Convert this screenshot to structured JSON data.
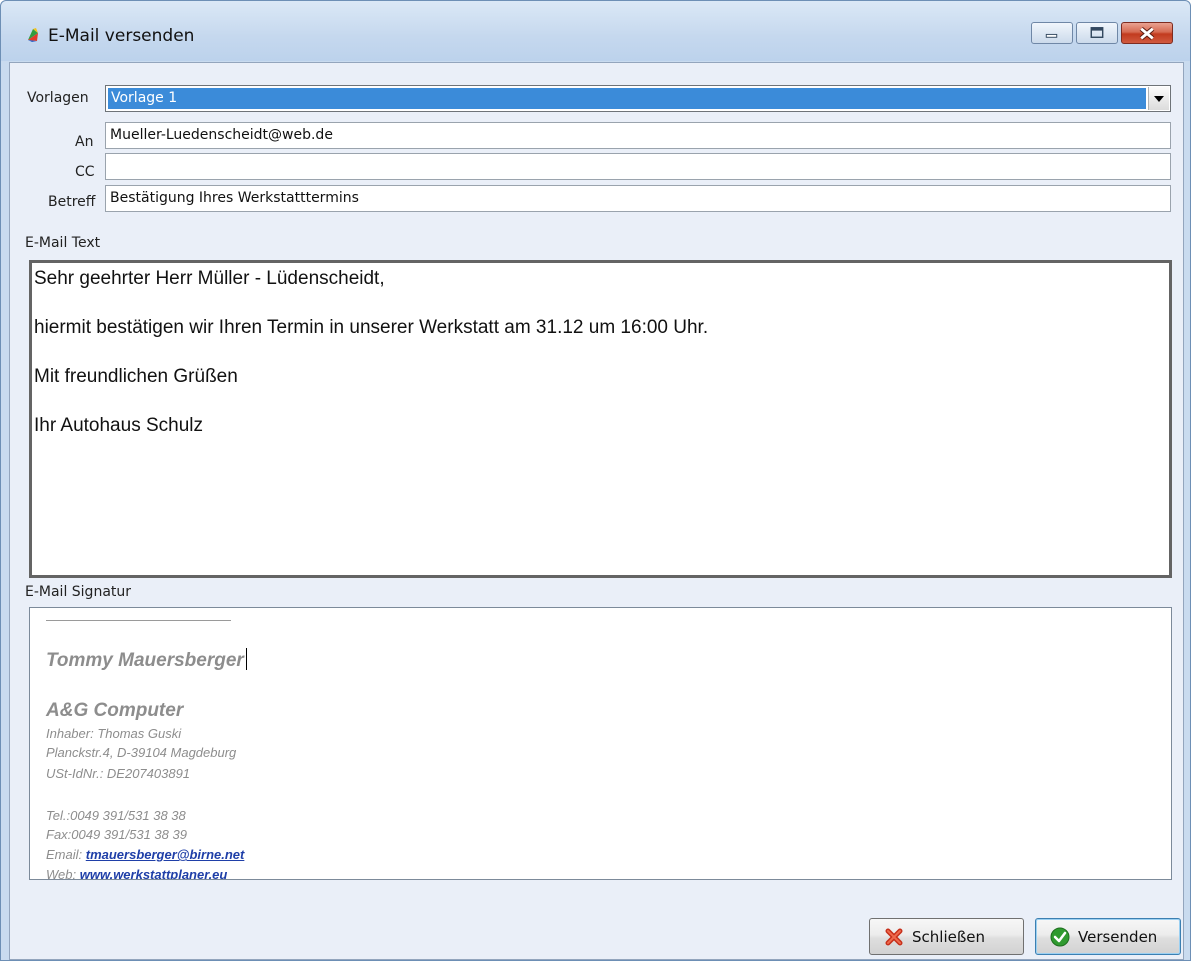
{
  "window": {
    "title": "E-Mail versenden",
    "icon": "app-logo-icon",
    "controls": [
      "minimize-icon",
      "maximize-icon",
      "close-icon"
    ]
  },
  "form": {
    "template_label": "Vorlagen",
    "template_value": "Vorlage 1",
    "to_label": "An",
    "to_value": "Mueller-Luedenscheidt@web.de",
    "cc_label": "CC",
    "cc_value": "",
    "subject_label": "Betreff",
    "subject_value": "Bestätigung Ihres Werkstatttermins"
  },
  "body": {
    "label": "E-Mail Text",
    "lines": [
      "Sehr geehrter Herr Müller - Lüdenscheidt,",
      "hiermit bestätigen wir Ihren Termin in unserer Werkstatt am 31.12 um 16:00 Uhr.",
      "Mit freundlichen Grüßen",
      "Ihr Autohaus Schulz"
    ]
  },
  "signature": {
    "label": "E-Mail Signatur",
    "name": "Tommy Mauersberger",
    "company": "A&G Computer",
    "owner": "Inhaber: Thomas Guski",
    "address": "Planckstr.4,  D-39104 Magdeburg",
    "vat": "USt-IdNr.: DE207403891",
    "tel": "Tel.:0049 391/531 38 38",
    "fax": "Fax:0049 391/531 38 39",
    "email_label": "Email:",
    "email": "tmauersberger@birne.net",
    "web_label": "Web:",
    "web": "www.werkstattplaner.eu"
  },
  "buttons": {
    "close_label": "Schließen",
    "close_icon": "red-x-icon",
    "send_label": "Versenden",
    "send_icon": "green-check-icon"
  },
  "colors": {
    "selection": "#3b8bd9",
    "link": "#1f3fa8",
    "close_button": "#c23b1f"
  }
}
